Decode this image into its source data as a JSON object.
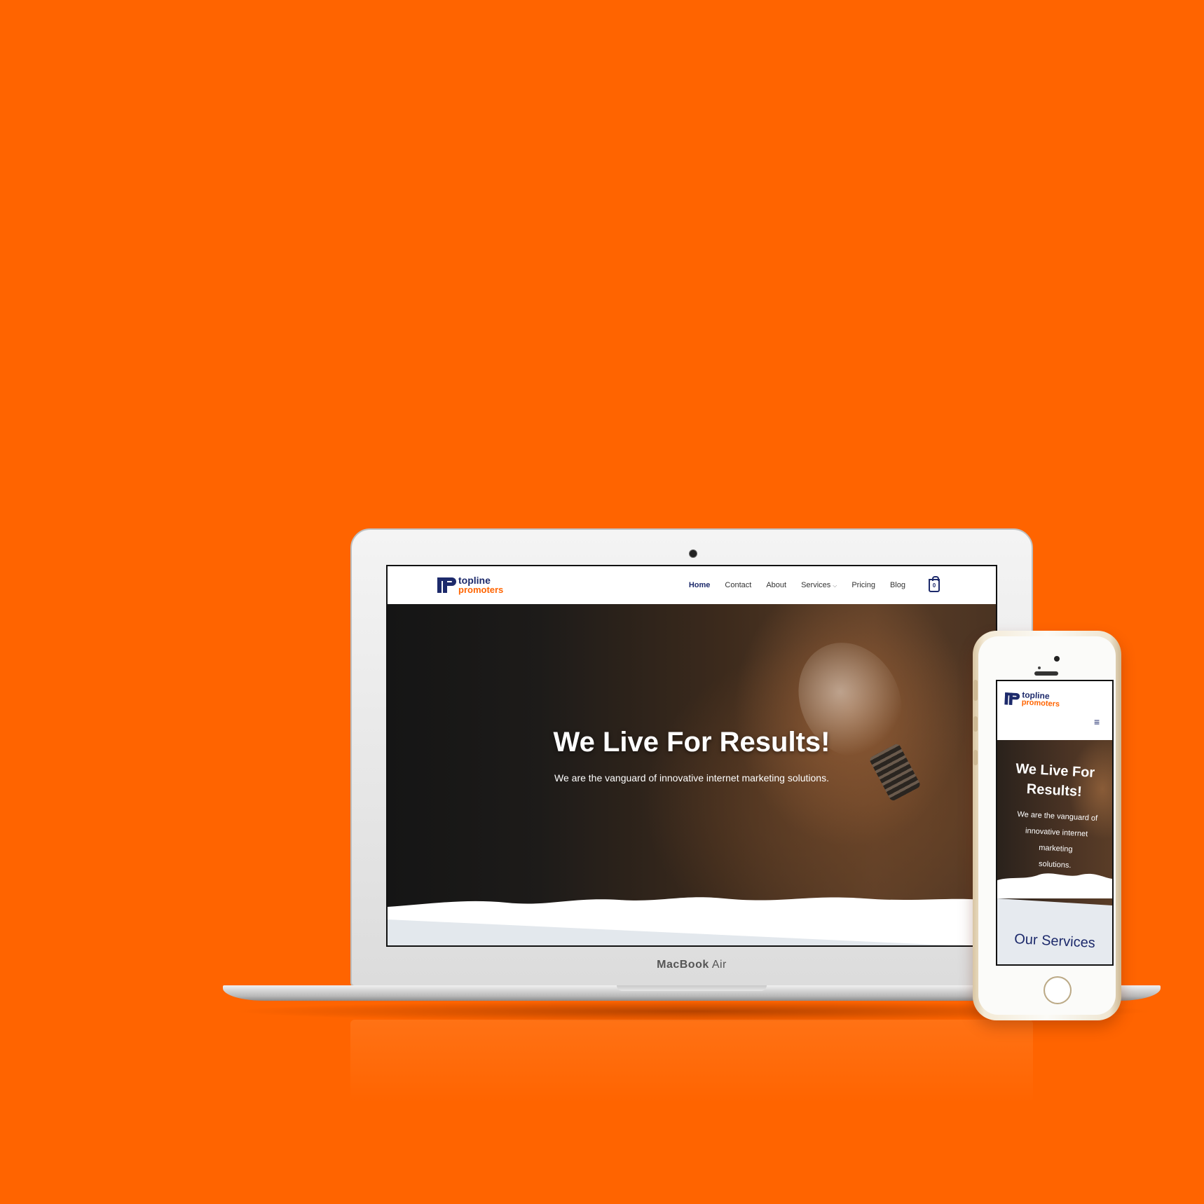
{
  "site": {
    "logo": {
      "line1": "topline",
      "line2": "promoters"
    },
    "nav": [
      {
        "label": "Home",
        "active": true
      },
      {
        "label": "Contact"
      },
      {
        "label": "About"
      },
      {
        "label": "Services",
        "has_dropdown": true
      },
      {
        "label": "Pricing"
      },
      {
        "label": "Blog"
      }
    ],
    "cart_count": "0",
    "hero": {
      "title": "We Live For Results!",
      "subtitle": "We are the vanguard of innovative internet marketing solutions."
    }
  },
  "mobile": {
    "hero_title_line1": "We Live For",
    "hero_title_line2": "Results!",
    "hero_sub_line1": "We are the vanguard of",
    "hero_sub_line2": "innovative internet marketing",
    "hero_sub_line3": "solutions.",
    "section_title": "Our Services",
    "menu_icon": "hamburger-icon"
  },
  "device": {
    "laptop_brand_bold": "MacBook",
    "laptop_brand_light": " Air"
  },
  "colors": {
    "background": "#ff6400",
    "brand_navy": "#1d2a6b",
    "brand_orange": "#ff6400"
  }
}
